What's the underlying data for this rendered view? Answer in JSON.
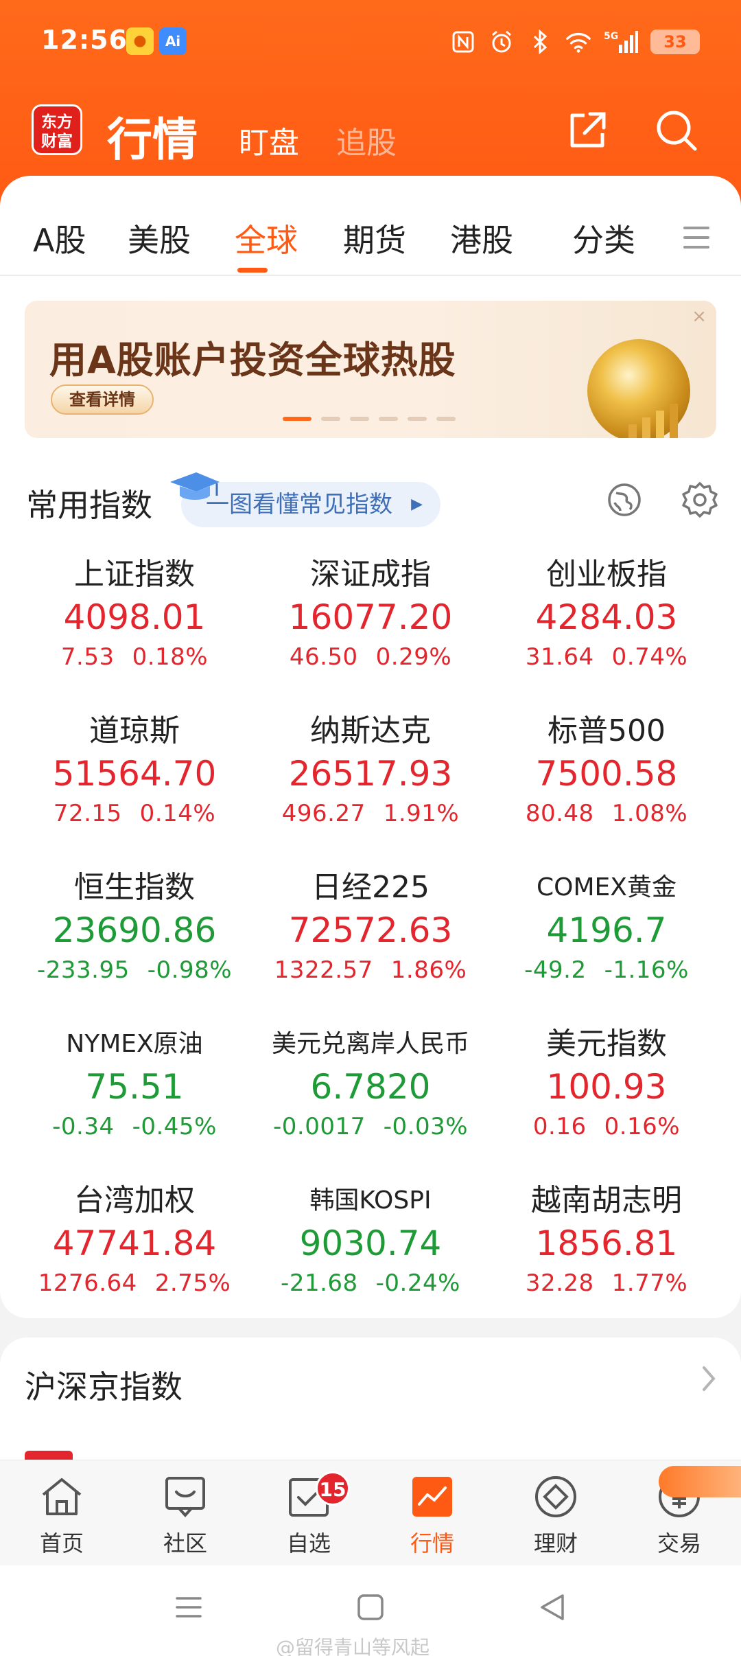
{
  "status_bar": {
    "time": "12:56",
    "network": "5G",
    "battery": "33"
  },
  "header": {
    "logo_text": "东方财富",
    "title": "行情",
    "tabs": [
      "盯盘",
      "追股"
    ]
  },
  "market_tabs": {
    "items": [
      "A股",
      "美股",
      "全球",
      "期货",
      "港股",
      "分类"
    ],
    "active": "全球"
  },
  "banner": {
    "title": "用A股账户投资全球热股",
    "button": "查看详情",
    "close": "×"
  },
  "common_indices": {
    "title": "常用指数",
    "guide_link": "一图看懂常见指数",
    "items": [
      {
        "name": "上证指数",
        "value": "4098.01",
        "change": "7.53",
        "percent": "0.18%",
        "trend": "up"
      },
      {
        "name": "深证成指",
        "value": "16077.20",
        "change": "46.50",
        "percent": "0.29%",
        "trend": "up"
      },
      {
        "name": "创业板指",
        "value": "4284.03",
        "change": "31.64",
        "percent": "0.74%",
        "trend": "up"
      },
      {
        "name": "道琼斯",
        "value": "51564.70",
        "change": "72.15",
        "percent": "0.14%",
        "trend": "up"
      },
      {
        "name": "纳斯达克",
        "value": "26517.93",
        "change": "496.27",
        "percent": "1.91%",
        "trend": "up"
      },
      {
        "name": "标普500",
        "value": "7500.58",
        "change": "80.48",
        "percent": "1.08%",
        "trend": "up"
      },
      {
        "name": "恒生指数",
        "value": "23690.86",
        "change": "-233.95",
        "percent": "-0.98%",
        "trend": "down"
      },
      {
        "name": "日经225",
        "value": "72572.63",
        "change": "1322.57",
        "percent": "1.86%",
        "trend": "up"
      },
      {
        "name": "COMEX黄金",
        "value": "4196.7",
        "change": "-49.2",
        "percent": "-1.16%",
        "trend": "down"
      },
      {
        "name": "NYMEX原油",
        "value": "75.51",
        "change": "-0.34",
        "percent": "-0.45%",
        "trend": "down"
      },
      {
        "name": "美元兑离岸人民币",
        "value": "6.7820",
        "change": "-0.0017",
        "percent": "-0.03%",
        "trend": "down"
      },
      {
        "name": "美元指数",
        "value": "100.93",
        "change": "0.16",
        "percent": "0.16%",
        "trend": "up"
      },
      {
        "name": "台湾加权",
        "value": "47741.84",
        "change": "1276.64",
        "percent": "2.75%",
        "trend": "up"
      },
      {
        "name": "韩国KOSPI",
        "value": "9030.74",
        "change": "-21.68",
        "percent": "-0.24%",
        "trend": "down"
      },
      {
        "name": "越南胡志明",
        "value": "1856.81",
        "change": "32.28",
        "percent": "1.77%",
        "trend": "up"
      }
    ]
  },
  "hs_section": {
    "title": "沪深京指数"
  },
  "bottom_nav": {
    "items": [
      "首页",
      "社区",
      "自选",
      "行情",
      "理财",
      "交易"
    ],
    "active": "行情",
    "watchlist_badge": "15"
  },
  "watermark": "@留得青山等风起",
  "colors": {
    "brand": "#ff5a14",
    "up": "#e3252d",
    "down": "#1e9a36"
  }
}
